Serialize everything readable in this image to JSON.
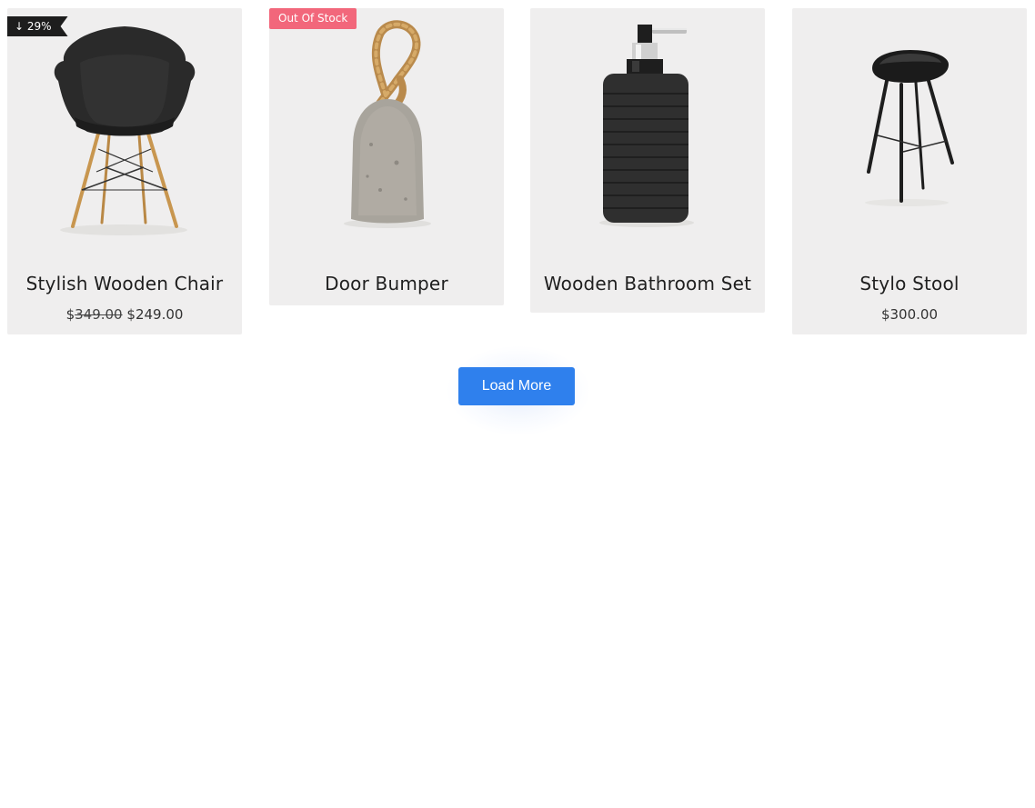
{
  "products": [
    {
      "title": "Stylish Wooden Chair",
      "badge": "↓ 29%",
      "currency": "$",
      "old_price": "349.00",
      "price": "249.00"
    },
    {
      "title": "Door Bumper",
      "badge": "Out Of Stock"
    },
    {
      "title": "Wooden Bathroom Set"
    },
    {
      "title": "Stylo Stool",
      "currency": "$",
      "price": "300.00"
    }
  ],
  "load_more": {
    "label": "Load More"
  },
  "colors": {
    "card_bg": "#efeeee",
    "button": "#2f80ed",
    "badge_discount": "#1d1d1d",
    "badge_out_of_stock": "#f2677b"
  },
  "icons": {
    "chair": "chair-image",
    "door_bumper": "door-bumper-image",
    "soap_dispenser": "soap-dispenser-image",
    "stool": "stool-image"
  }
}
